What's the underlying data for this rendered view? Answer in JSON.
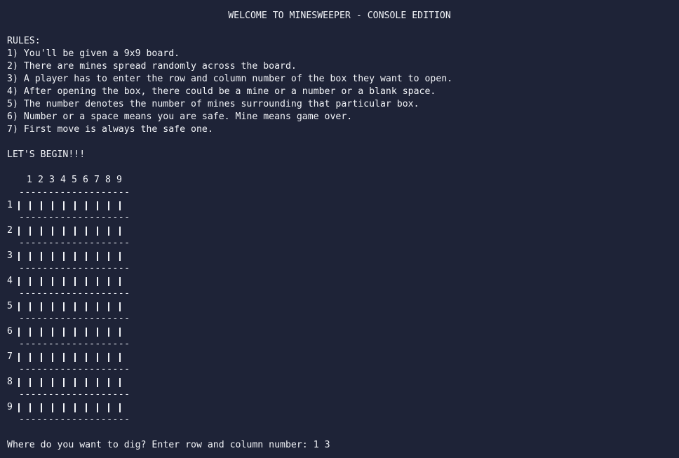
{
  "title": "WELCOME TO MINESWEEPER - CONSOLE EDITION",
  "rules_heading": "RULES:",
  "rules": [
    "1) You'll be given a 9x9 board.",
    "2) There are mines spread randomly across the board.",
    "3) A player has to enter the row and column number of the box they want to open.",
    "4) After opening the box, there could be a mine or a number or a blank space.",
    "5) The number denotes the number of mines surrounding that particular box.",
    "6) Number or a space means you are safe. Mine means game over.",
    "7) First move is always the safe one."
  ],
  "begin_text": "LET'S BEGIN!!!",
  "board": {
    "columns": [
      "1",
      "2",
      "3",
      "4",
      "5",
      "6",
      "7",
      "8",
      "9"
    ],
    "rows": [
      "1",
      "2",
      "3",
      "4",
      "5",
      "6",
      "7",
      "8",
      "9"
    ],
    "separator": "-------------------",
    "cells": [
      [
        "",
        "",
        "",
        "",
        "",
        "",
        "",
        "",
        ""
      ],
      [
        "",
        "",
        "",
        "",
        "",
        "",
        "",
        "",
        ""
      ],
      [
        "",
        "",
        "",
        "",
        "",
        "",
        "",
        "",
        ""
      ],
      [
        "",
        "",
        "",
        "",
        "",
        "",
        "",
        "",
        ""
      ],
      [
        "",
        "",
        "",
        "",
        "",
        "",
        "",
        "",
        ""
      ],
      [
        "",
        "",
        "",
        "",
        "",
        "",
        "",
        "",
        ""
      ],
      [
        "",
        "",
        "",
        "",
        "",
        "",
        "",
        "",
        ""
      ],
      [
        "",
        "",
        "",
        "",
        "",
        "",
        "",
        "",
        ""
      ],
      [
        "",
        "",
        "",
        "",
        "",
        "",
        "",
        "",
        ""
      ]
    ]
  },
  "prompt": {
    "text": "Where do you want to dig? Enter row and column number: ",
    "input_value": "1 3"
  },
  "colors": {
    "background": "#1e2337",
    "text": "#f2f4f8"
  }
}
